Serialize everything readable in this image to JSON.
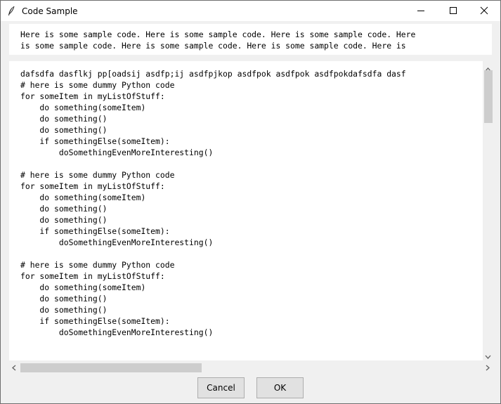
{
  "window": {
    "title": "Code Sample",
    "icon": "feather-icon",
    "controls": [
      "minimize-icon",
      "maximize-icon",
      "close-icon"
    ]
  },
  "intro_text": {
    "lines": [
      "Here is some sample code. Here is some sample code. Here is some sample code. Here",
      "is some sample code. Here is some sample code. Here is some sample code. Here is"
    ]
  },
  "code": {
    "lines": [
      "dafsdfa dasflkj pp[oadsij asdfp;ij asdfpjkop asdfpok asdfpok asdfpokdafsdfa dasf",
      "# here is some dummy Python code",
      "for someItem in myListOfStuff:",
      "    do something(someItem)",
      "    do something()",
      "    do something()",
      "    if somethingElse(someItem):",
      "        doSomethingEvenMoreInteresting()",
      "",
      "# here is some dummy Python code",
      "for someItem in myListOfStuff:",
      "    do something(someItem)",
      "    do something()",
      "    do something()",
      "    if somethingElse(someItem):",
      "        doSomethingEvenMoreInteresting()",
      "",
      "# here is some dummy Python code",
      "for someItem in myListOfStuff:",
      "    do something(someItem)",
      "    do something()",
      "    do something()",
      "    if somethingElse(someItem):",
      "        doSomethingEvenMoreInteresting()"
    ]
  },
  "buttons": {
    "cancel": "Cancel",
    "ok": "OK"
  }
}
